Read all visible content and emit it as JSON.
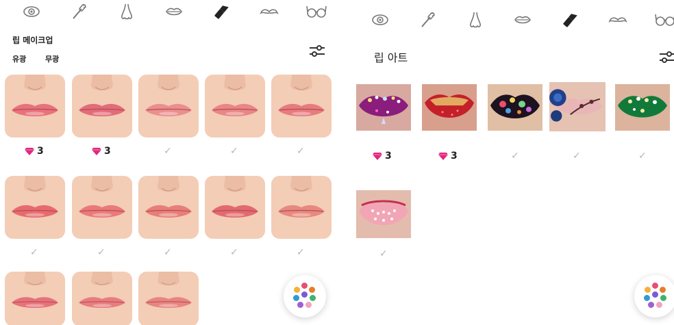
{
  "left": {
    "section_title": "립 메이크업",
    "sub_tabs": [
      "유광",
      "무광"
    ],
    "tabs": [
      "eye-icon",
      "mascara-icon",
      "nose-icon",
      "lips-icon",
      "lipstick-icon",
      "mustache-icon",
      "glasses-icon"
    ],
    "rows": [
      [
        {
          "price": "3"
        },
        {
          "price": "3"
        },
        {
          "owned": true
        },
        {
          "owned": true
        },
        {
          "owned": true
        }
      ],
      [
        {
          "owned": true
        },
        {
          "owned": true
        },
        {
          "owned": true
        },
        {
          "owned": true
        },
        {
          "owned": true
        }
      ],
      [
        {},
        {},
        {}
      ]
    ],
    "lip_colors": [
      [
        "#e8727b",
        "#e36c79",
        "#eb8e8e",
        "#e98686",
        "#e67c7e"
      ],
      [
        "#e76b6e",
        "#ea7a78",
        "#e87e78",
        "#e26a6e",
        "#e7897f"
      ],
      [
        "#e6727a",
        "#e87c7e",
        "#e8857f"
      ]
    ]
  },
  "right": {
    "section_title": "립 아트",
    "tabs": [
      "eye-icon",
      "mascara-icon",
      "nose-icon",
      "lips-icon",
      "lipstick-icon",
      "mustache-icon",
      "glasses-icon"
    ],
    "items": [
      {
        "price": "3",
        "theme": "purple-jewel"
      },
      {
        "price": "3",
        "theme": "red-glitter"
      },
      {
        "owned": true,
        "theme": "floral-dark"
      },
      {
        "owned": true,
        "theme": "blue-rose"
      },
      {
        "owned": true,
        "theme": "green-jewel"
      },
      {
        "owned": true,
        "theme": "pink-pearl"
      }
    ]
  },
  "colors": {
    "gem": "#e0287e",
    "check": "#b5b5b5",
    "skin": "#f3cdb6",
    "fab_dots": [
      "#e94f6f",
      "#f4b23a",
      "#e67d2e",
      "#2f9bd7",
      "#7b5bd6",
      "#3fb36a",
      "#a05fd0",
      "#f2a3c4"
    ]
  }
}
